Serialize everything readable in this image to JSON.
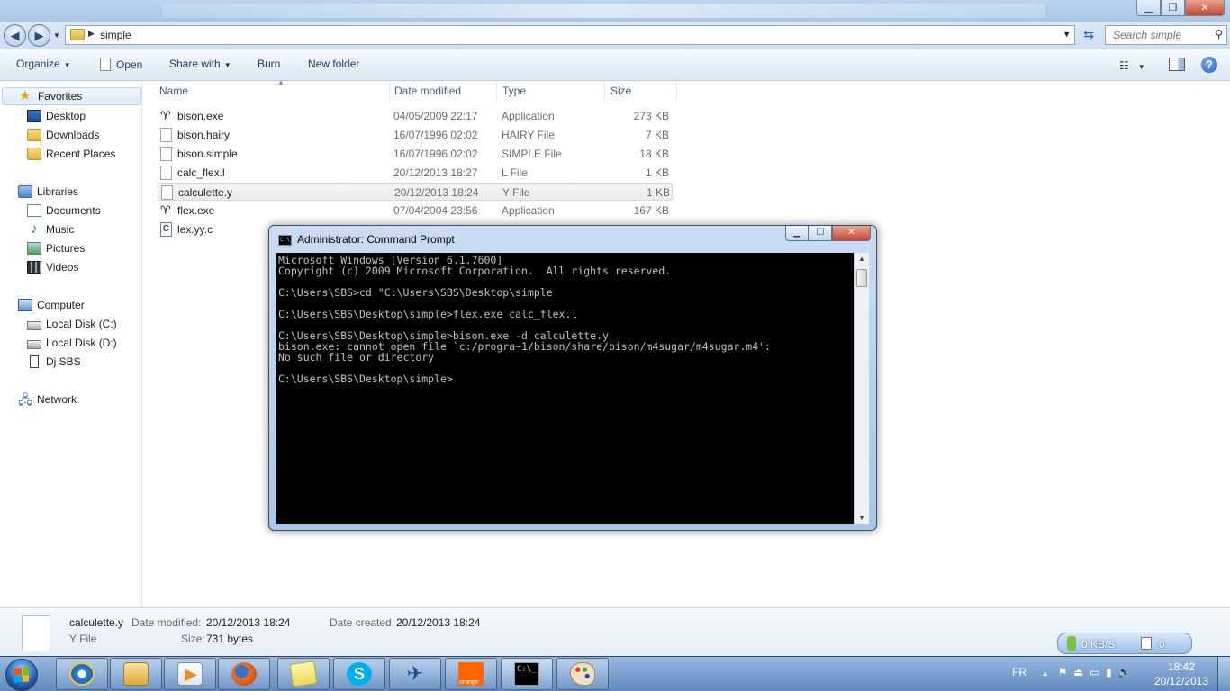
{
  "explorer": {
    "address": {
      "crumb": "simple",
      "search_placeholder": "Search simple"
    },
    "commands": {
      "organize": "Organize",
      "open": "Open",
      "share_with": "Share with",
      "burn": "Burn",
      "new_folder": "New folder"
    },
    "nav": {
      "favorites": "Favorites",
      "desktop": "Desktop",
      "downloads": "Downloads",
      "recent_places": "Recent Places",
      "libraries": "Libraries",
      "documents": "Documents",
      "music": "Music",
      "pictures": "Pictures",
      "videos": "Videos",
      "computer": "Computer",
      "local_c": "Local Disk (C:)",
      "local_d": "Local Disk (D:)",
      "dj_sbs": "Dj SBS",
      "network": "Network"
    },
    "columns": {
      "name": "Name",
      "date": "Date modified",
      "type": "Type",
      "size": "Size"
    },
    "files": [
      {
        "name": "bison.exe",
        "date": "04/05/2009 22:17",
        "type": "Application",
        "size": "273 KB",
        "icon": "gnu-icon"
      },
      {
        "name": "bison.hairy",
        "date": "16/07/1996 02:02",
        "type": "HAIRY File",
        "size": "7 KB",
        "icon": "file-icon"
      },
      {
        "name": "bison.simple",
        "date": "16/07/1996 02:02",
        "type": "SIMPLE File",
        "size": "18 KB",
        "icon": "file-icon"
      },
      {
        "name": "calc_flex.l",
        "date": "20/12/2013 18:27",
        "type": "L File",
        "size": "1 KB",
        "icon": "file-icon"
      },
      {
        "name": "calculette.y",
        "date": "20/12/2013 18:24",
        "type": "Y File",
        "size": "1 KB",
        "icon": "file-icon"
      },
      {
        "name": "flex.exe",
        "date": "07/04/2004 23:56",
        "type": "Application",
        "size": "167 KB",
        "icon": "gnu-icon"
      },
      {
        "name": "lex.yy.c",
        "date": "",
        "type": "",
        "size": "",
        "icon": "c-file-icon"
      }
    ],
    "details": {
      "file_name": "calculette.y",
      "file_type": "Y File",
      "date_modified_label": "Date modified:",
      "date_modified": "20/12/2013 18:24",
      "date_created_label": "Date created:",
      "date_created": "20/12/2013 18:24",
      "size_label": "Size:",
      "size": "731 bytes"
    },
    "net_meter": {
      "speed": "0 KB/S",
      "count": "0"
    }
  },
  "cmd": {
    "title": "Administrator: Command Prompt",
    "icon_text": "C:\\_",
    "output": "Microsoft Windows [Version 6.1.7600]\nCopyright (c) 2009 Microsoft Corporation.  All rights reserved.\n\nC:\\Users\\SBS>cd \"C:\\Users\\SBS\\Desktop\\simple\n\nC:\\Users\\SBS\\Desktop\\simple>flex.exe calc_flex.l\n\nC:\\Users\\SBS\\Desktop\\simple>bison.exe -d calculette.y\nbison.exe: cannot open file `c:/progra~1/bison/share/bison/m4sugar/m4sugar.m4':\nNo such file or directory\n\nC:\\Users\\SBS\\Desktop\\simple>"
  },
  "taskbar": {
    "orange_label": "orange",
    "cmd_label": "C:\\_",
    "language": "FR",
    "time": "18:42",
    "date": "20/12/2013"
  },
  "colors": {
    "accent": "#1f5db8",
    "selection": "#dde9f7",
    "console_bg": "#000000",
    "console_fg": "#c0c0c0"
  }
}
